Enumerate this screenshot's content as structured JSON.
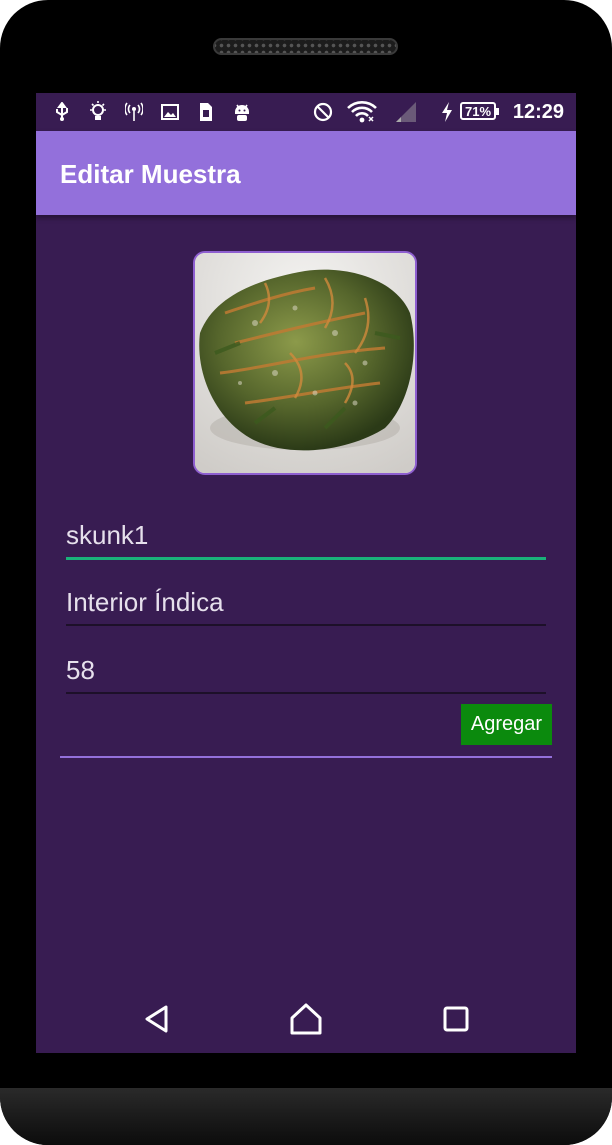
{
  "status_bar": {
    "battery": "71%",
    "time": "12:29",
    "icons": [
      "usb-icon",
      "lightbulb-icon",
      "hotspot-icon",
      "image-icon",
      "sim-icon",
      "android-icon",
      "do-not-disturb-icon",
      "wifi-icon",
      "signal-icon",
      "charging-icon"
    ]
  },
  "app_bar": {
    "title": "Editar Muestra"
  },
  "form": {
    "name_value": "skunk1",
    "type_value": "Interior Índica",
    "number_value": "58",
    "add_button": "Agregar"
  },
  "nav": {
    "icons": [
      "back-icon",
      "home-icon",
      "recents-icon"
    ]
  },
  "colors": {
    "app_bar": "#9370db",
    "background": "#381c52",
    "accent": "#1ab17a",
    "button": "#0b8a0d"
  }
}
